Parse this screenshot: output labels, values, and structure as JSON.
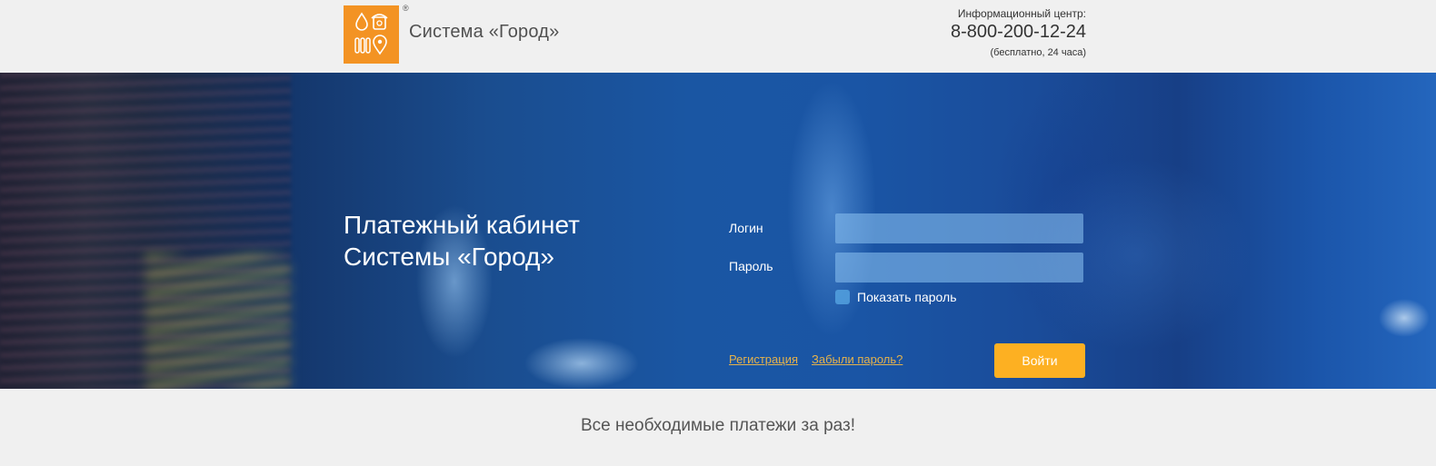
{
  "header": {
    "brand_name": "Система «Город»",
    "reg_mark": "®",
    "info_label": "Информационный центр:",
    "phone": "8-800-200-12-24",
    "phone_note": "(бесплатно, 24 часа)"
  },
  "hero": {
    "title_line1": "Платежный кабинет",
    "title_line2": "Системы «Город»"
  },
  "login_form": {
    "login_label": "Логин",
    "login_value": "",
    "password_label": "Пароль",
    "password_value": "",
    "show_password_label": "Показать пароль",
    "show_password_checked": false,
    "register_link": "Регистрация",
    "forgot_link": "Забыли пароль?",
    "submit_label": "Войти"
  },
  "footer": {
    "tagline": "Все необходимые платежи за раз!"
  },
  "colors": {
    "logo_orange": "#f39323",
    "button_yellow": "#fdb022",
    "link_gold": "#e5b24c",
    "hero_blue": "#1a55a5"
  },
  "icons": [
    "water-drop-icon",
    "phone-icon",
    "radiator-icon",
    "location-pin-icon"
  ]
}
